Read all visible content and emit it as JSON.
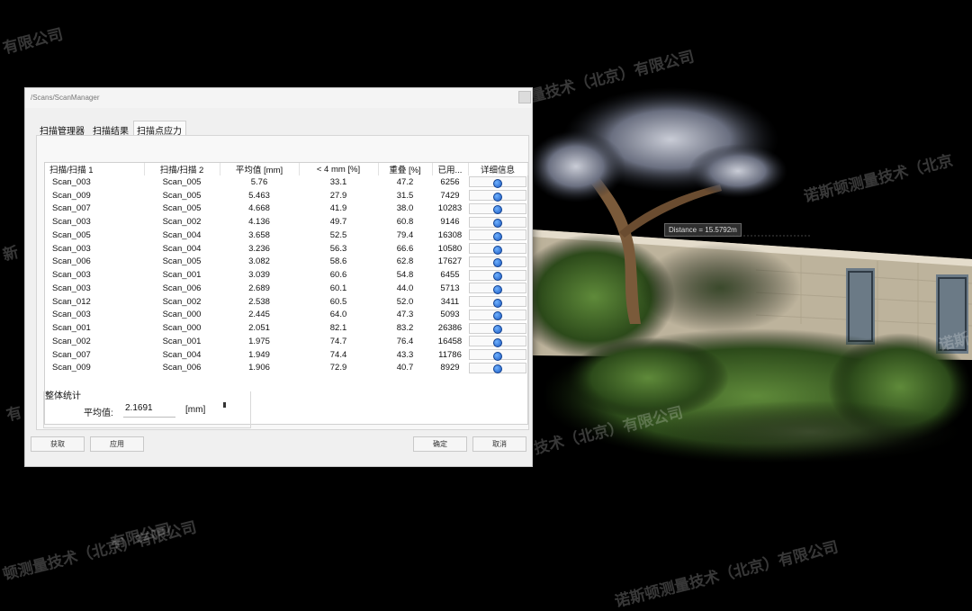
{
  "viewport": {
    "distance_label": "Distance = 15.5792m",
    "watermarks": [
      "有限公司",
      "诺斯顿测量技术（北京）有限公司",
      "诺斯顿测量技术（北京",
      "有限公司",
      "技术（北京）有限公司",
      "顿测量技术（北京）有限公司",
      "诺斯顿测量技术（北京）有限公司",
      "有限公司",
      "技术（北京）有限公司",
      "新",
      "有",
      "诺斯"
    ]
  },
  "dialog": {
    "title": "/Scans/ScanManager",
    "tabs": [
      "扫描管理器",
      "扫描结果",
      "扫描点应力"
    ],
    "active_tab": "扫描点应力",
    "table": {
      "headers": [
        "扫描/扫描 1",
        "扫描/扫描 2",
        "平均值 [mm]",
        "< 4 mm [%]",
        "重叠 [%]",
        "已用...",
        "详细信息"
      ],
      "rows": [
        [
          "Scan_003",
          "Scan_005",
          "5.76",
          "33.1",
          "47.2",
          "6256"
        ],
        [
          "Scan_009",
          "Scan_005",
          "5.463",
          "27.9",
          "31.5",
          "7429"
        ],
        [
          "Scan_007",
          "Scan_005",
          "4.668",
          "41.9",
          "38.0",
          "10283"
        ],
        [
          "Scan_003",
          "Scan_002",
          "4.136",
          "49.7",
          "60.8",
          "9146"
        ],
        [
          "Scan_005",
          "Scan_004",
          "3.658",
          "52.5",
          "79.4",
          "16308"
        ],
        [
          "Scan_003",
          "Scan_004",
          "3.236",
          "56.3",
          "66.6",
          "10580"
        ],
        [
          "Scan_006",
          "Scan_005",
          "3.082",
          "58.6",
          "62.8",
          "17627"
        ],
        [
          "Scan_003",
          "Scan_001",
          "3.039",
          "60.6",
          "54.8",
          "6455"
        ],
        [
          "Scan_003",
          "Scan_006",
          "2.689",
          "60.1",
          "44.0",
          "5713"
        ],
        [
          "Scan_012",
          "Scan_002",
          "2.538",
          "60.5",
          "52.0",
          "3411"
        ],
        [
          "Scan_003",
          "Scan_000",
          "2.445",
          "64.0",
          "47.3",
          "5093"
        ],
        [
          "Scan_001",
          "Scan_000",
          "2.051",
          "82.1",
          "83.2",
          "26386"
        ],
        [
          "Scan_002",
          "Scan_001",
          "1.975",
          "74.7",
          "76.4",
          "16458"
        ],
        [
          "Scan_007",
          "Scan_004",
          "1.949",
          "74.4",
          "43.3",
          "11786"
        ],
        [
          "Scan_009",
          "Scan_006",
          "1.906",
          "72.9",
          "40.7",
          "8929"
        ]
      ]
    },
    "overall": {
      "title": "整体统计",
      "avg_label": "平均值:",
      "avg_value": "2.1691",
      "unit": "[mm]"
    },
    "buttons": {
      "fetch": "获取",
      "apply": "应用",
      "ok": "确定",
      "cancel": "取消"
    }
  }
}
